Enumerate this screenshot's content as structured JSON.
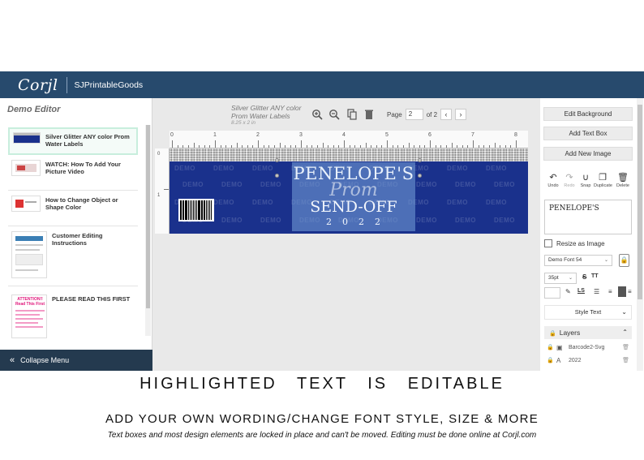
{
  "app": {
    "logo": "Corjl",
    "brand": "SJPrintableGoods"
  },
  "left_panel": {
    "title": "Demo Editor",
    "items": [
      {
        "label": "Silver Glitter ANY color Prom Water Labels"
      },
      {
        "label": "WATCH: How To Add Your Picture Video"
      },
      {
        "label": "How to Change Object or Shape Color"
      },
      {
        "label": "Customer Editing Instructions"
      },
      {
        "label": "PLEASE READ THIS FIRST",
        "thumb_text": "ATTENTION!! Read This First"
      }
    ],
    "collapse_label": "Collapse Menu",
    "collapse_icon": "double-chevron-left-icon"
  },
  "toolbar": {
    "doc_title": "Silver Glitter ANY color Prom Water Labels",
    "doc_size": "8.25 x 2 in",
    "page_label": "Page",
    "page_value": "2",
    "page_of": "of 2"
  },
  "ruler": {
    "numbers": [
      "0",
      "1",
      "2",
      "3",
      "4",
      "5",
      "6",
      "7",
      "8"
    ]
  },
  "canvas": {
    "watermark": "DEMO",
    "textbox": {
      "line1": "PENELOPE'S",
      "line2": "Prom",
      "line3": "SEND-OFF",
      "line4": "2022"
    },
    "label_color": "#1a318c"
  },
  "right_panel": {
    "buttons": [
      "Edit Background",
      "Add Text Box",
      "Add New Image"
    ],
    "actions": [
      {
        "label": "Undo",
        "icon": "undo-icon"
      },
      {
        "label": "Redo",
        "icon": "redo-icon"
      },
      {
        "label": "Snap",
        "icon": "magnet-icon"
      },
      {
        "label": "Duplicate",
        "icon": "duplicate-icon"
      },
      {
        "label": "Delete",
        "icon": "trash-icon"
      }
    ],
    "text_value": "PENELOPE'S",
    "resize_label": "Resize as Image",
    "font": "Demo Font 54",
    "size": "35pt",
    "format": {
      "strike": "S",
      "caps": "TT",
      "letter_spacing": "LS"
    },
    "style_text": "Style Text",
    "layers_title": "Layers",
    "layers": [
      {
        "type_icon": "image-icon",
        "name": "Barcode2-Svg"
      },
      {
        "type_icon": "text-icon",
        "type": "A",
        "name": "2022"
      }
    ]
  },
  "captions": {
    "headline": "HIGHLIGHTED TEXT IS EDITABLE",
    "subhead": "ADD YOUR OWN WORDING/CHANGE FONT STYLE, SIZE & MORE",
    "note": "Text boxes and most design elements are locked in place and can't be moved. Editing must be done online at Corjl.com"
  }
}
